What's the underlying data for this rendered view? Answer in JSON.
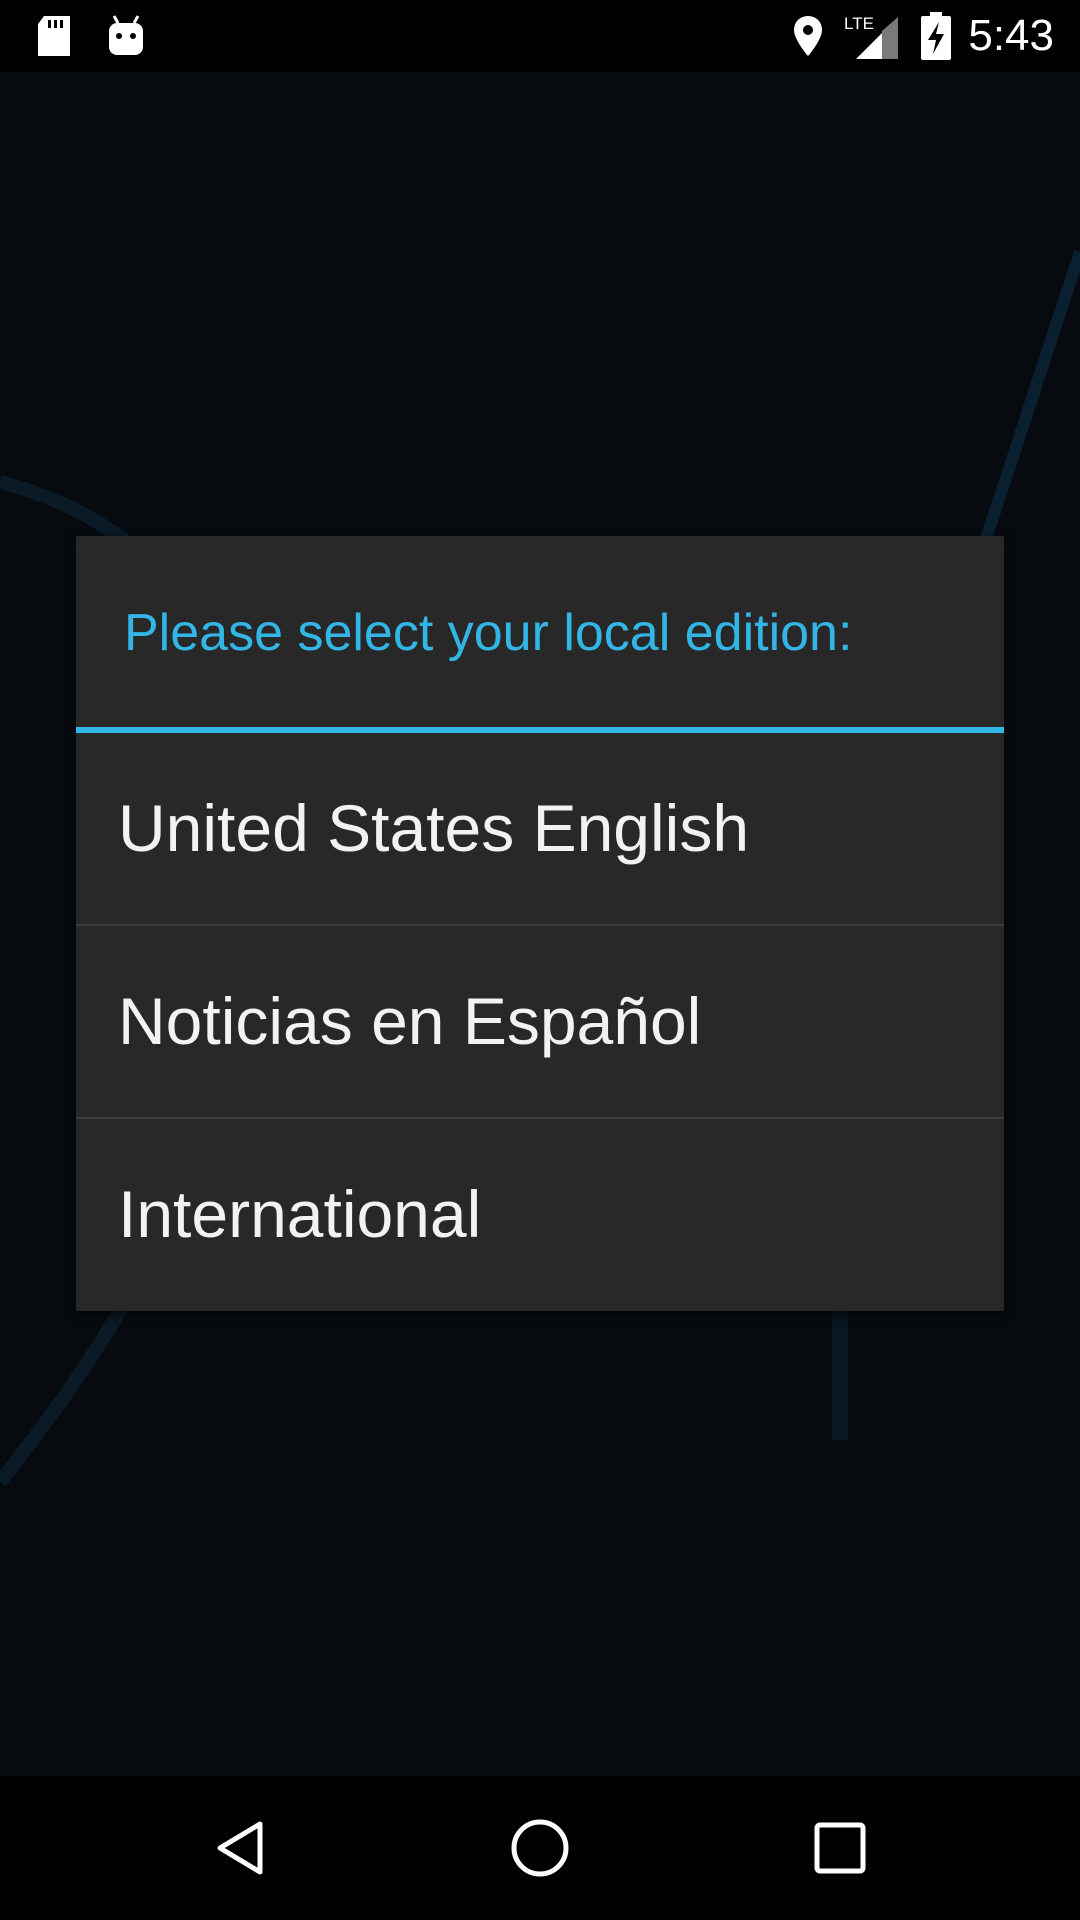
{
  "status_bar": {
    "time": "5:43",
    "network_label": "LTE",
    "left_icons": [
      "sd-card-icon",
      "android-icon"
    ],
    "right_icons": [
      "location-icon",
      "lte-signal-icon",
      "battery-charging-icon"
    ]
  },
  "dialog": {
    "title": "Please select your local edition:",
    "accent_color": "#33b5e5",
    "options": [
      {
        "label": "United States English"
      },
      {
        "label": "Noticias en Español"
      },
      {
        "label": "International"
      }
    ]
  },
  "nav_bar": {
    "buttons": [
      "back-icon",
      "home-icon",
      "recents-icon"
    ]
  }
}
